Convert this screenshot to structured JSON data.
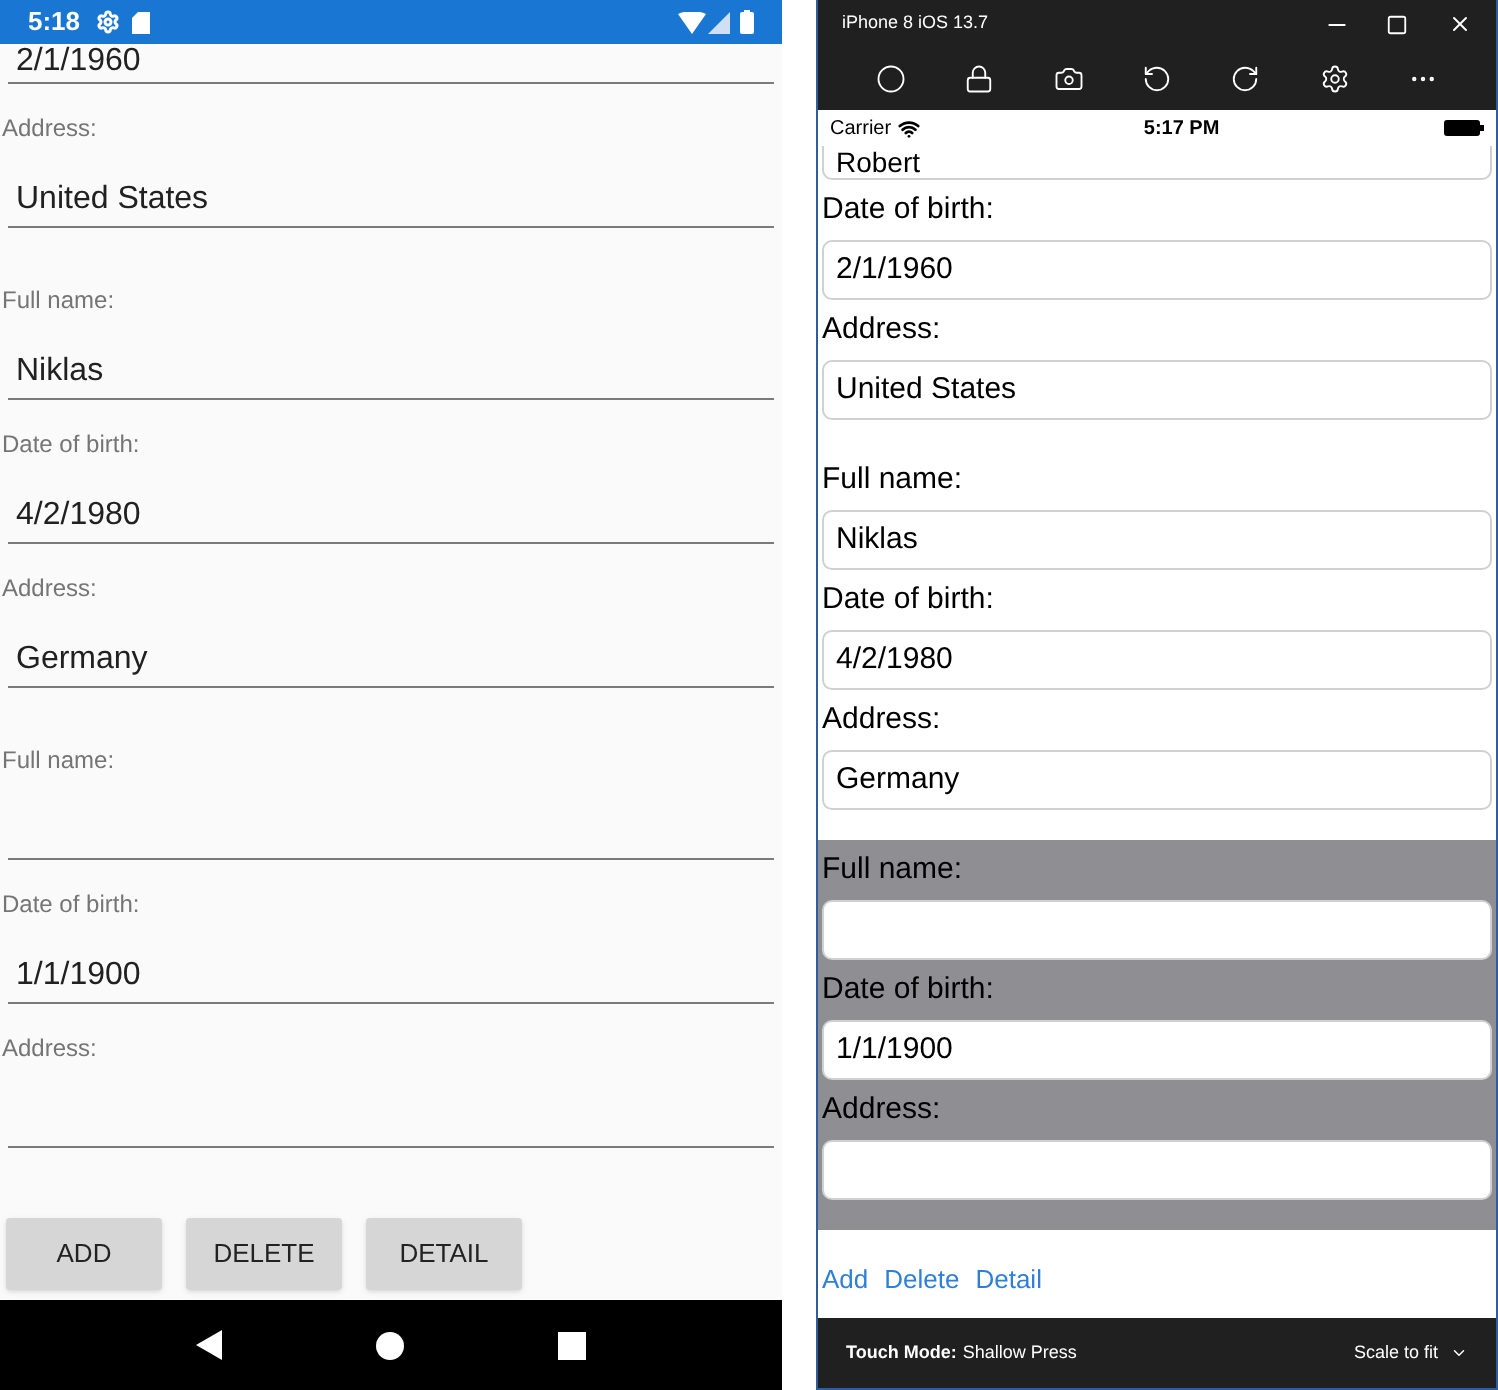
{
  "android": {
    "status_time": "5:18",
    "records": [
      {
        "fields": [
          {
            "kind": "partial",
            "value": "2/1/1960"
          },
          {
            "kind": "full",
            "label": "Address:",
            "value": "United States"
          }
        ]
      },
      {
        "fields": [
          {
            "kind": "full",
            "label": "Full name:",
            "value": "Niklas"
          },
          {
            "kind": "full",
            "label": "Date of birth:",
            "value": "4/2/1980"
          },
          {
            "kind": "full",
            "label": "Address:",
            "value": "Germany"
          }
        ]
      },
      {
        "fields": [
          {
            "kind": "full",
            "label": "Full name:"
          },
          {
            "kind": "full",
            "label": "Date of birth:",
            "value": "1/1/1900"
          },
          {
            "kind": "full",
            "label": "Address:"
          }
        ]
      }
    ],
    "buttons": [
      "ADD",
      "DELETE",
      "DETAIL"
    ]
  },
  "ios": {
    "title": "iPhone 8 iOS 13.7",
    "carrier": "Carrier",
    "time": "5:17 PM",
    "records": [
      {
        "selected": false,
        "fields": [
          {
            "kind": "partial",
            "value": "Robert"
          },
          {
            "kind": "full",
            "label": "Date of birth:",
            "value": "2/1/1960"
          },
          {
            "kind": "full",
            "label": "Address:",
            "value": "United States"
          }
        ]
      },
      {
        "selected": false,
        "fields": [
          {
            "kind": "full",
            "label": "Full name:",
            "value": "Niklas"
          },
          {
            "kind": "full",
            "label": "Date of birth:",
            "value": "4/2/1980"
          },
          {
            "kind": "full",
            "label": "Address:",
            "value": "Germany"
          }
        ]
      },
      {
        "selected": true,
        "fields": [
          {
            "kind": "full",
            "label": "Full name:"
          },
          {
            "kind": "full",
            "label": "Date of birth:",
            "value": "1/1/1900"
          },
          {
            "kind": "full",
            "label": "Address:"
          }
        ]
      }
    ],
    "buttons": [
      "Add",
      "Delete",
      "Detail"
    ],
    "touch_mode_label": "Touch Mode:",
    "touch_mode_value": "Shallow Press",
    "scale": "Scale to fit"
  }
}
